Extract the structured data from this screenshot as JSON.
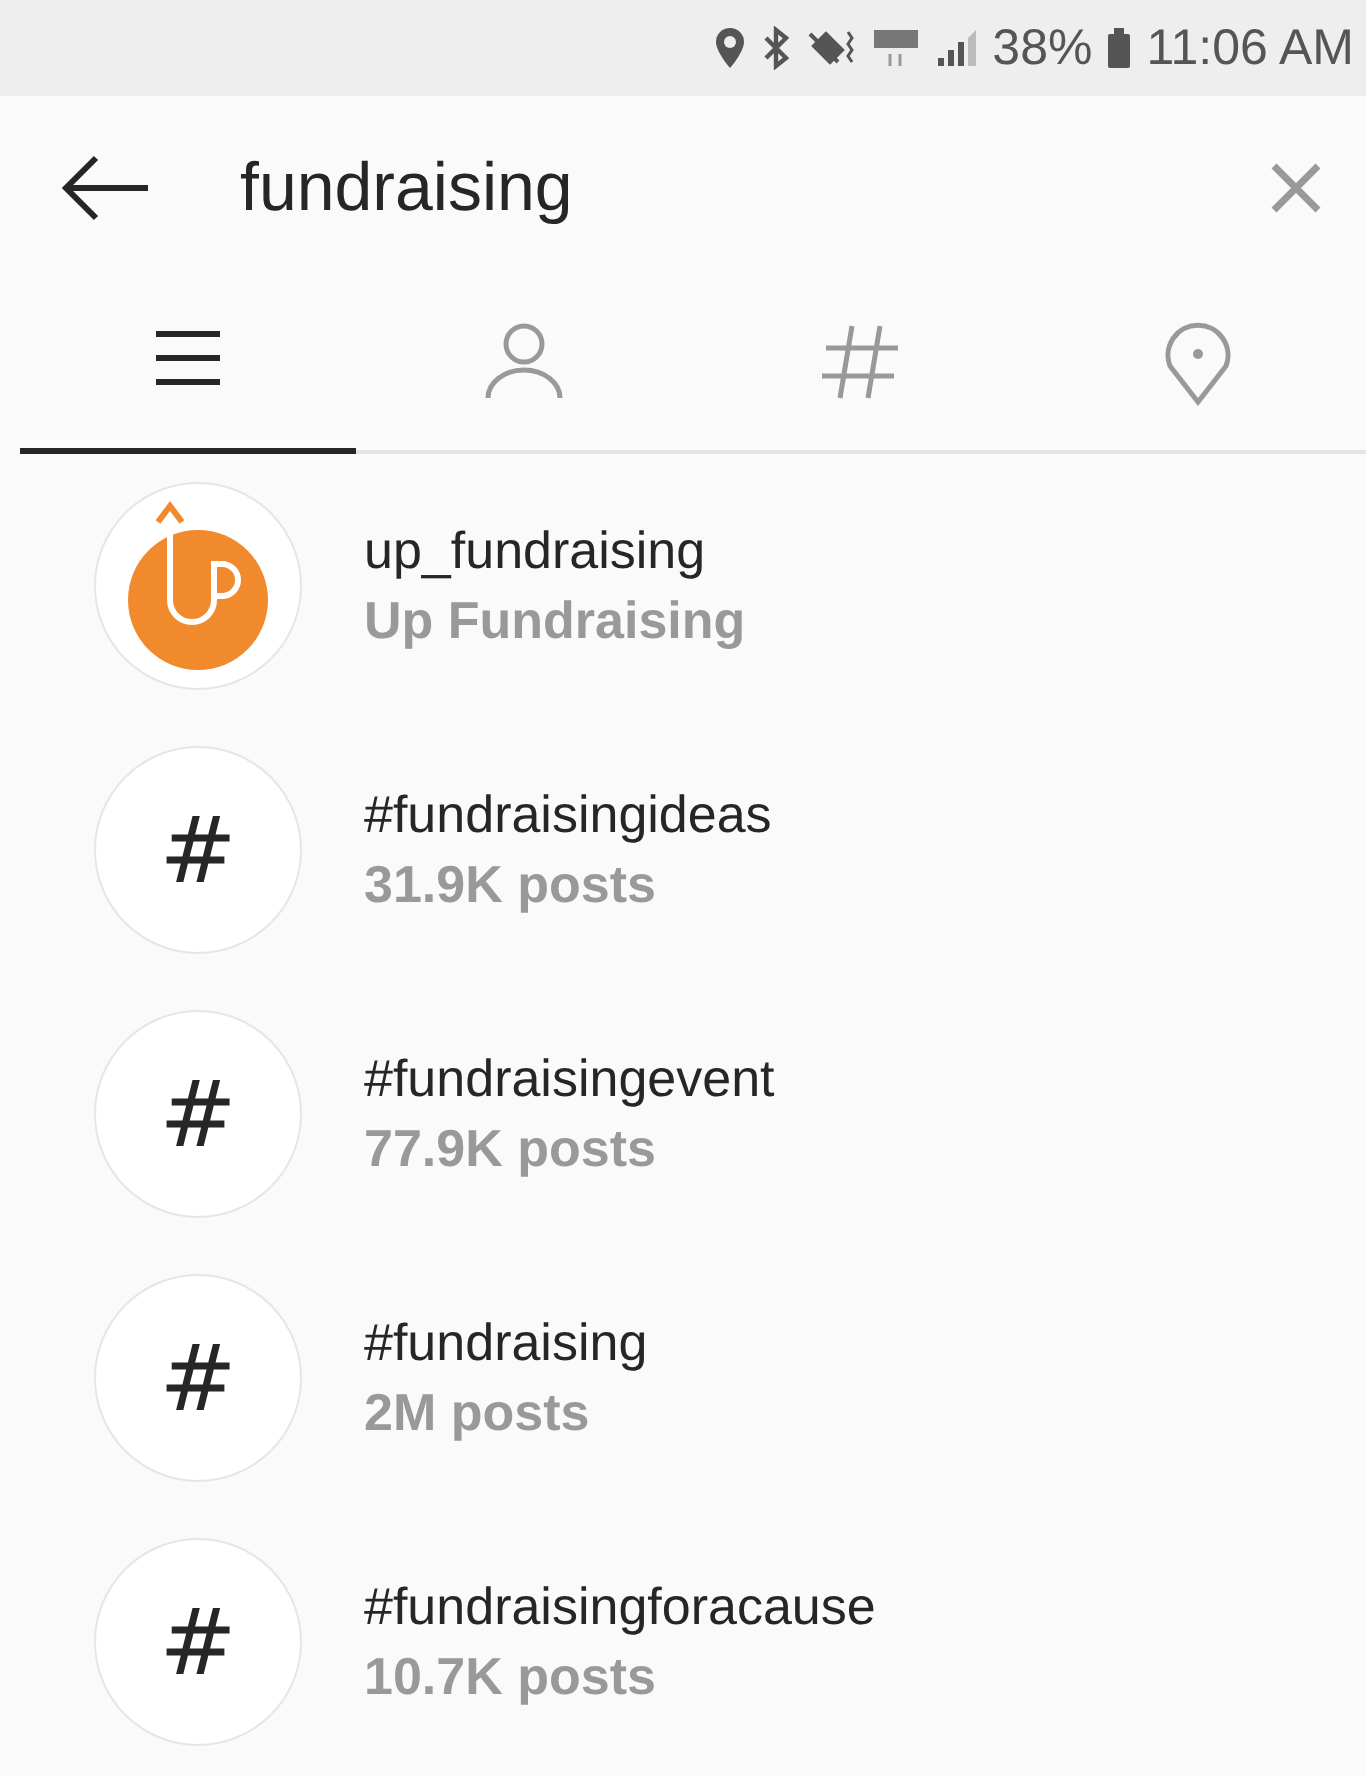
{
  "status_bar": {
    "battery": "38%",
    "time": "11:06 AM"
  },
  "search": {
    "value": "fundraising"
  },
  "tabs": [
    {
      "kind": "top",
      "selected": true
    },
    {
      "kind": "people",
      "selected": false
    },
    {
      "kind": "tags",
      "selected": false
    },
    {
      "kind": "places",
      "selected": false
    }
  ],
  "results": [
    {
      "kind": "account",
      "title": "up_fundraising",
      "subtitle": "Up Fundraising"
    },
    {
      "kind": "hashtag",
      "icon": "#",
      "title": "#fundraisingideas",
      "subtitle": "31.9K posts"
    },
    {
      "kind": "hashtag",
      "icon": "#",
      "title": "#fundraisingevent",
      "subtitle": "77.9K posts"
    },
    {
      "kind": "hashtag",
      "icon": "#",
      "title": "#fundraising",
      "subtitle": "2M posts"
    },
    {
      "kind": "hashtag",
      "icon": "#",
      "title": "#fundraisingforacause",
      "subtitle": "10.7K posts"
    }
  ]
}
